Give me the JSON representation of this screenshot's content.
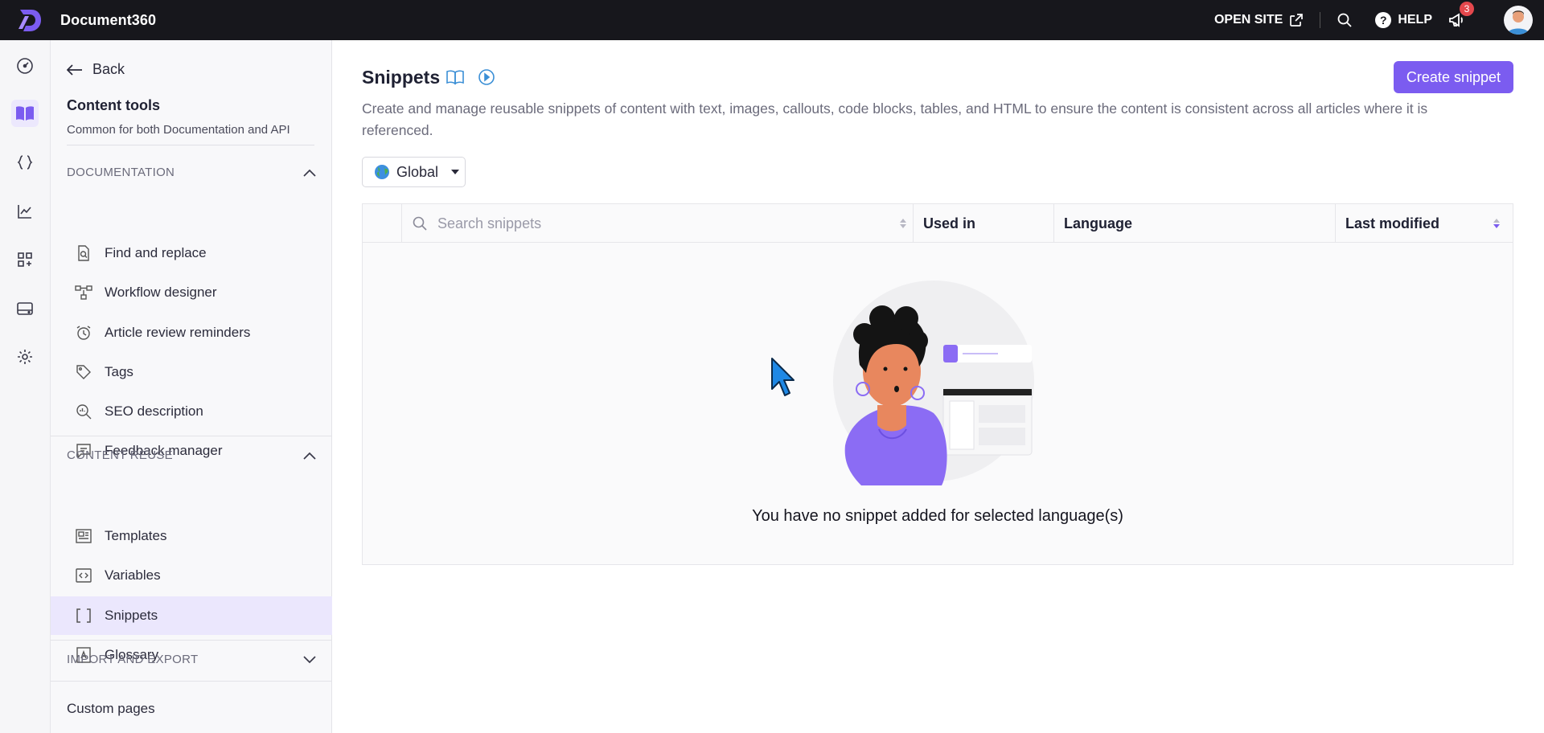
{
  "app": {
    "title": "Document360"
  },
  "topbar": {
    "open_site": "OPEN SITE",
    "help": "HELP",
    "help_glyph": "?",
    "notifications_count": "3"
  },
  "sidebar": {
    "back": "Back",
    "title": "Content tools",
    "subtitle": "Common for both Documentation and API",
    "sections": {
      "documentation": {
        "label": "DOCUMENTATION",
        "items": [
          "Find and replace",
          "Workflow designer",
          "Article review reminders",
          "Tags",
          "SEO description",
          "Feedback manager"
        ]
      },
      "content_reuse": {
        "label": "CONTENT REUSE",
        "items": [
          "Templates",
          "Variables",
          "Snippets",
          "Glossary"
        ]
      },
      "import_export": {
        "label": "IMPORT AND EXPORT"
      }
    },
    "custom_pages": "Custom pages",
    "active_item": "Snippets"
  },
  "main": {
    "title": "Snippets",
    "create_button": "Create snippet",
    "description": "Create and manage reusable snippets of content with text, images, callouts, code blocks, tables, and HTML to ensure the content is consistent across all articles where it is referenced.",
    "language_select": {
      "value": "Global",
      "icon": "globe-icon"
    },
    "table": {
      "search_placeholder": "Search snippets",
      "columns": [
        "Used in",
        "Language",
        "Last modified"
      ],
      "empty_message": "You have no snippet added for selected language(s)"
    }
  },
  "colors": {
    "accent": "#7b5cf0",
    "topbar": "#17171c",
    "active_bg": "#ebe7fd",
    "badge": "#e5484d"
  }
}
